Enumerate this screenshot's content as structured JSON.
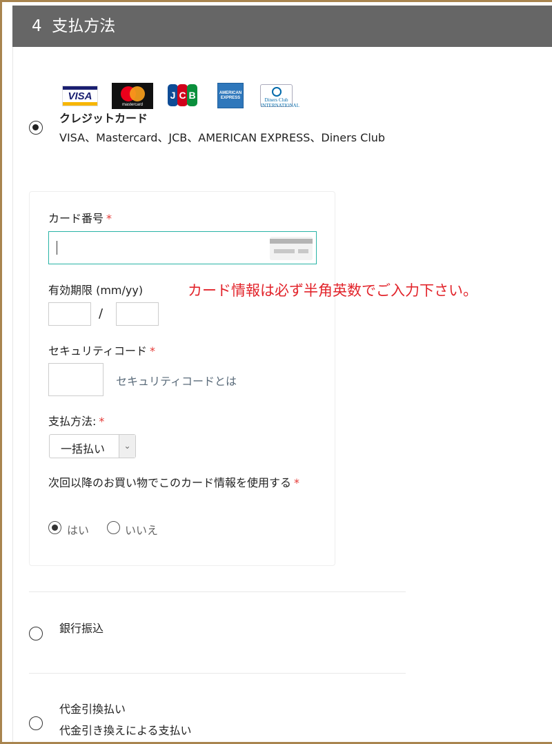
{
  "section": {
    "number": "4",
    "title": "支払方法"
  },
  "card_brands": [
    {
      "name": "VISA",
      "icon": "visa-logo"
    },
    {
      "name": "mastercard",
      "icon": "mastercard-logo"
    },
    {
      "name": "JCB",
      "icon": "jcb-logo"
    },
    {
      "name": "AMERICAN EXPRESS",
      "icon": "amex-logo"
    },
    {
      "name": "Diners Club INTERNATIONAL",
      "icon": "diners-club-logo"
    }
  ],
  "logo_text": {
    "visa": "VISA",
    "mastercard": "mastercard",
    "jcb": [
      "J",
      "C",
      "B"
    ],
    "amex": "AMERICAN EXPRESS",
    "diners": "Diners Club INTERNATIONAL"
  },
  "options": {
    "credit_card": {
      "title": "クレジットカード",
      "description": "VISA、Mastercard、JCB、AMERICAN EXPRESS、Diners Club",
      "selected": true
    },
    "bank_transfer": {
      "title": "銀行振込",
      "selected": false
    },
    "cod": {
      "title": "代金引換払い",
      "description": "代金引き換えによる支払い",
      "selected": false
    }
  },
  "card_form": {
    "card_number_label": "カード番号",
    "required_mark": "*",
    "card_number_value": "",
    "expiry_label": "有効期限 (mm/yy)",
    "expiry_separator": "/",
    "expiry_month_value": "",
    "expiry_year_value": "",
    "notice": "カード情報は必ず半角英数でご入力下さい。",
    "security_code_label": "セキュリティコード",
    "security_code_value": "",
    "security_code_link": "セキュリティコードとは",
    "payment_method_label": "支払方法:",
    "payment_method_selected": "一括払い",
    "save_card_label": "次回以降のお買い物でこのカード情報を使用する",
    "save_card_yes": "はい",
    "save_card_no": "いいえ",
    "save_card_value": "yes"
  },
  "colors": {
    "header_bg": "#666666",
    "frame": "#a8844e",
    "required": "#e53935",
    "notice": "#e2242b",
    "focus_border": "#27b3a5"
  }
}
